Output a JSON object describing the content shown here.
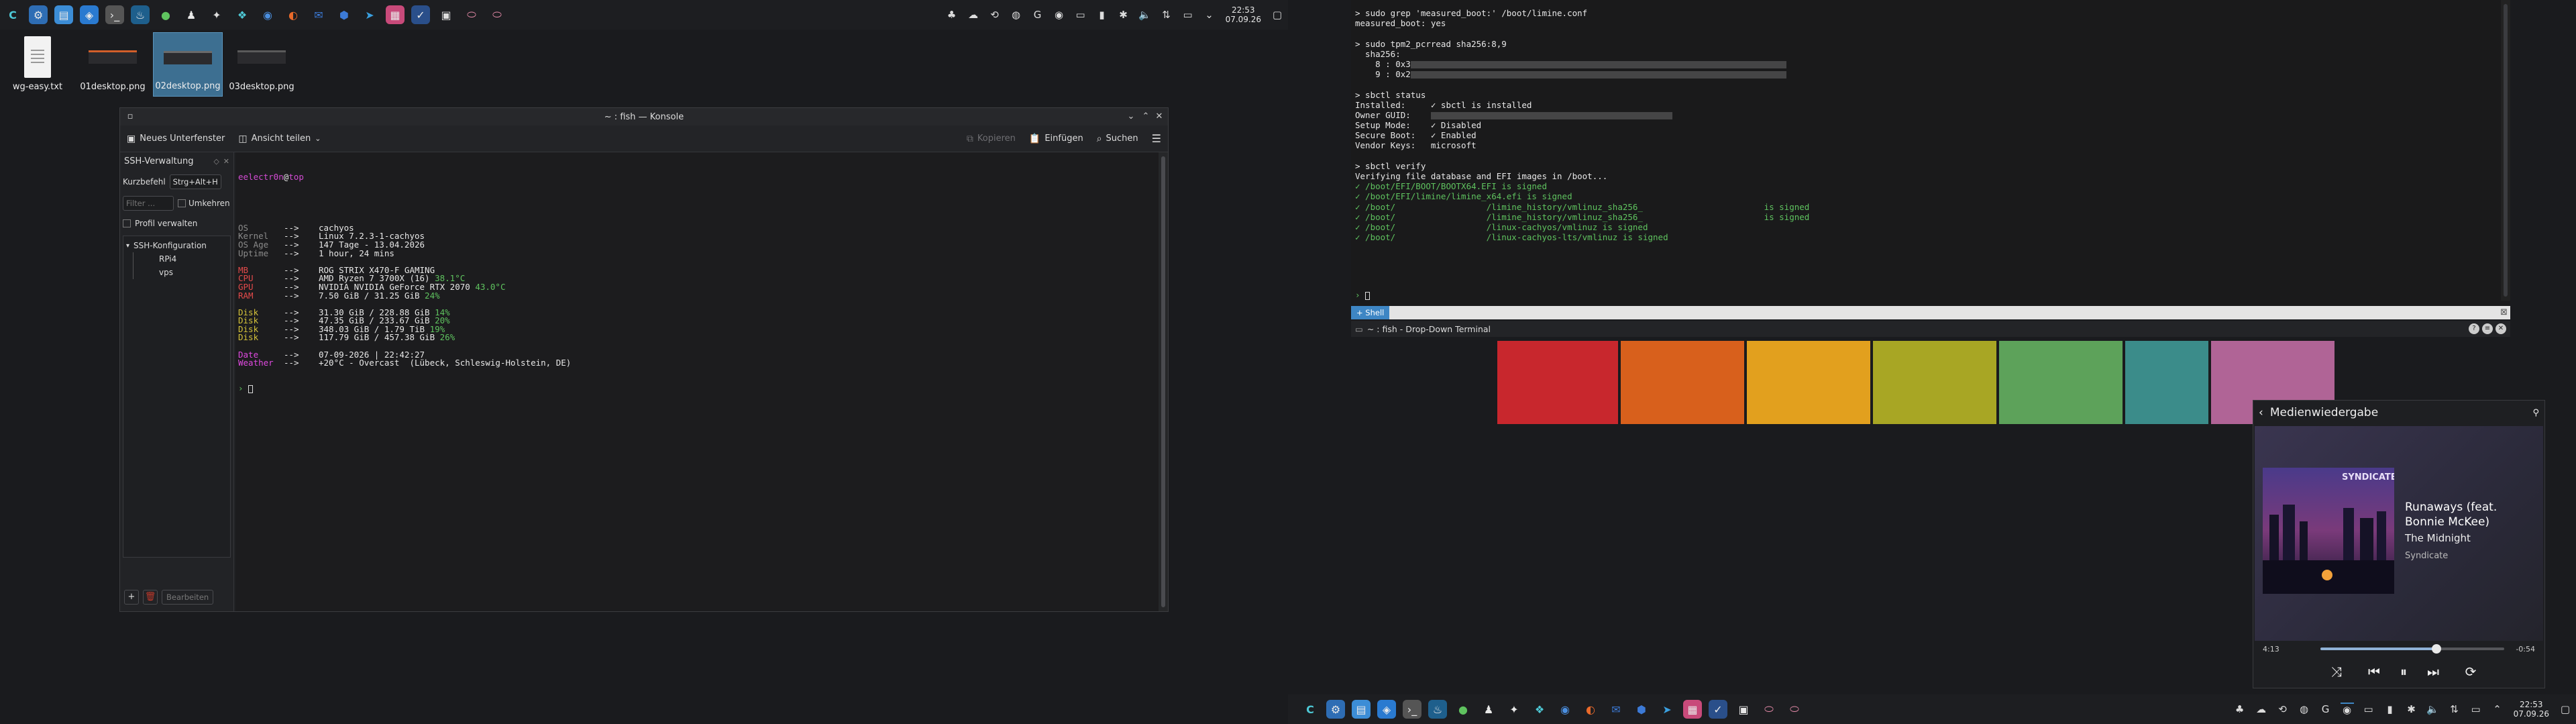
{
  "top_panel": {
    "clock_time": "22:53",
    "clock_date": "07.09.26"
  },
  "bottom_panel": {
    "clock_time": "22:53",
    "clock_date": "07.09.26"
  },
  "desktop_icons": [
    {
      "label": "wg-easy.txt"
    },
    {
      "label": "01desktop.png"
    },
    {
      "label": "02desktop.png"
    },
    {
      "label": "03desktop.png"
    }
  ],
  "konsole": {
    "title": "~ : fish — Konsole",
    "toolbar": {
      "split": "Neues Unterfenster",
      "view": "Ansicht teilen",
      "copy": "Kopieren",
      "paste": "Einfügen",
      "search": "Suchen"
    },
    "sidebar": {
      "title": "SSH-Verwaltung",
      "shortcut_label": "Kurzbefehl",
      "shortcut_value": "Strg+Alt+H",
      "filter_placeholder": "Filter ...",
      "wrap_label": "Umkehren",
      "manage_label": "Profil verwalten",
      "tree_root": "SSH-Konfiguration",
      "hosts": [
        "RPi4",
        "vps"
      ],
      "edit_label": "Bearbeiten"
    },
    "prompt_user": "eelectr0n",
    "prompt_at": "@",
    "prompt_host": "top",
    "fetch": [
      {
        "key": "OS",
        "val": "cachyos",
        "extra": "",
        "color": "c-gry",
        "extracol": ""
      },
      {
        "key": "Kernel",
        "val": "Linux 7.2.3-1-cachyos",
        "extra": "",
        "color": "c-gry",
        "extracol": ""
      },
      {
        "key": "OS Age",
        "val": "147 Tage - 13.04.2026",
        "extra": "",
        "color": "c-gry",
        "extracol": ""
      },
      {
        "key": "Uptime",
        "val": "1 hour, 24 mins",
        "extra": "",
        "color": "c-gry",
        "extracol": ""
      },
      {
        "key": "",
        "val": "",
        "extra": "",
        "color": "",
        "extracol": ""
      },
      {
        "key": "MB",
        "val": "ROG STRIX X470-F GAMING",
        "extra": "",
        "color": "c-red",
        "extracol": ""
      },
      {
        "key": "CPU",
        "val": "AMD Ryzen 7 3700X (16)",
        "extra": "38.1°C",
        "color": "c-red",
        "extracol": "c-grn"
      },
      {
        "key": "GPU",
        "val": "NVIDIA NVIDIA GeForce RTX 2070",
        "extra": "43.0°C",
        "color": "c-red",
        "extracol": "c-grn"
      },
      {
        "key": "RAM",
        "val": "7.50 GiB / 31.25 GiB",
        "extra": "24%",
        "color": "c-red",
        "extracol": "c-grn"
      },
      {
        "key": "",
        "val": "",
        "extra": "",
        "color": "",
        "extracol": ""
      },
      {
        "key": "Disk",
        "val": "31.30 GiB / 228.88 GiB",
        "extra": "14%",
        "color": "c-yel",
        "extracol": "c-grn"
      },
      {
        "key": "Disk",
        "val": "47.35 GiB / 233.67 GiB",
        "extra": "20%",
        "color": "c-yel",
        "extracol": "c-grn"
      },
      {
        "key": "Disk",
        "val": "348.03 GiB / 1.79 TiB",
        "extra": "19%",
        "color": "c-yel",
        "extracol": "c-grn"
      },
      {
        "key": "Disk",
        "val": "117.79 GiB / 457.38 GiB",
        "extra": "26%",
        "color": "c-yel",
        "extracol": "c-grn"
      },
      {
        "key": "",
        "val": "",
        "extra": "",
        "color": "",
        "extracol": ""
      },
      {
        "key": "Date",
        "val": "07-09-2026 | 22:42:27",
        "extra": "",
        "color": "c-pnk",
        "extracol": ""
      },
      {
        "key": "Weather",
        "val": "+20°C - Overcast  (Lübeck, Schleswig-Holstein, DE)",
        "extra": "",
        "color": "c-pnk",
        "extracol": ""
      }
    ],
    "arrow": "-->"
  },
  "dropdown": {
    "title": "~ : fish - Drop-Down Terminal",
    "tab_label": "Shell",
    "lines": [
      {
        "t": "> sudo grep 'measured_boot:' /boot/limine.conf",
        "c": "c-wht"
      },
      {
        "t": "measured_boot: yes",
        "c": "c-wht"
      },
      {
        "t": "",
        "c": ""
      },
      {
        "t": "> sudo tpm2_pcrread sha256:8,9",
        "c": "c-wht"
      },
      {
        "t": "  sha256:",
        "c": "c-wht"
      },
      {
        "t": "    8 : 0x3",
        "c": "c-wht",
        "blur": 280
      },
      {
        "t": "    9 : 0x2",
        "c": "c-wht",
        "blur": 280
      },
      {
        "t": "",
        "c": ""
      },
      {
        "t": "> sbctl status",
        "c": "c-wht"
      },
      {
        "t": "Installed:     ✓ sbctl is installed",
        "c": "c-wht"
      },
      {
        "t": "Owner GUID:    ",
        "c": "c-wht",
        "blur": 180
      },
      {
        "t": "Setup Mode:    ✓ Disabled",
        "c": "c-wht"
      },
      {
        "t": "Secure Boot:   ✓ Enabled",
        "c": "c-wht"
      },
      {
        "t": "Vendor Keys:   microsoft",
        "c": "c-wht"
      },
      {
        "t": "",
        "c": ""
      },
      {
        "t": "> sbctl verify",
        "c": "c-wht"
      },
      {
        "t": "Verifying file database and EFI images in /boot...",
        "c": "c-wht"
      },
      {
        "t": "✓ /boot/EFI/BOOT/BOOTX64.EFI is signed",
        "c": "c-wht"
      },
      {
        "t": "✓ /boot/EFI/limine/limine_x64.efi is signed",
        "c": "c-wht"
      },
      {
        "t": "✓ /boot/                  /limine_history/vmlinuz_sha256_                        is signed",
        "c": "c-wht"
      },
      {
        "t": "✓ /boot/                  /limine_history/vmlinuz_sha256_                        is signed",
        "c": "c-wht"
      },
      {
        "t": "✓ /boot/                  /linux-cachyos/vmlinuz is signed",
        "c": "c-wht"
      },
      {
        "t": "✓ /boot/                  /linux-cachyos-lts/vmlinuz is signed",
        "c": "c-wht"
      }
    ]
  },
  "wallpaper": {
    "colors": [
      "#c8272d",
      "#d8601c",
      "#e2a01e",
      "#a8a624",
      "#5da25a",
      "#3b8c8a",
      "#b06496"
    ]
  },
  "media": {
    "header": "Medienwiedergabe",
    "album_art_text": "SYNDICATE",
    "title": "Runaways (feat. Bonnie McKee)",
    "artist": "The Midnight",
    "album": "Syndicate",
    "elapsed": "4:13",
    "remaining": "-0:54",
    "progress": 0.63
  }
}
